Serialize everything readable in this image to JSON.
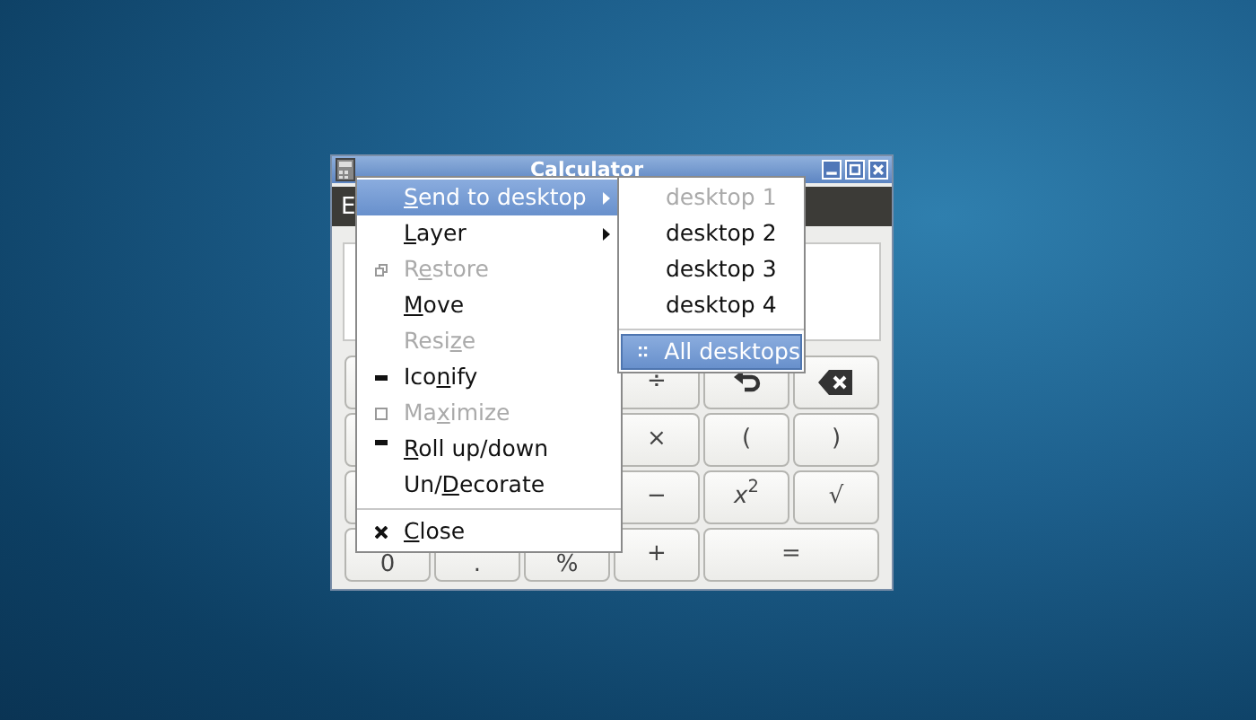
{
  "window": {
    "title": "Calculator",
    "menubar_text": "E"
  },
  "keypad": [
    [
      {
        "kind": "text",
        "label": "÷"
      },
      {
        "kind": "undo"
      },
      {
        "kind": "backspace"
      }
    ],
    [
      {
        "kind": "text",
        "label": "×"
      },
      {
        "kind": "text",
        "label": "("
      },
      {
        "kind": "text",
        "label": ")"
      }
    ],
    [
      {
        "kind": "text",
        "label": "−"
      },
      {
        "kind": "text",
        "label": "*x*$^{2}$"
      },
      {
        "kind": "text",
        "label": "√"
      }
    ],
    [
      {
        "kind": "low",
        "label": "0"
      },
      {
        "kind": "low",
        "label": "."
      },
      {
        "kind": "low",
        "label": "%"
      },
      {
        "kind": "text",
        "label": "+"
      },
      {
        "kind": "wide",
        "label": "="
      }
    ]
  ],
  "window_menu": [
    {
      "kind": "item",
      "key": "S",
      "after": "end to desktop",
      "submenu": true,
      "disabled": false,
      "selected": true
    },
    {
      "kind": "item",
      "key": "L",
      "after": "ayer",
      "submenu": true,
      "disabled": false,
      "selected": false
    },
    {
      "kind": "item",
      "before": "R",
      "key": "e",
      "after": "store",
      "submenu": false,
      "disabled": true,
      "selected": false
    },
    {
      "kind": "item",
      "key": "M",
      "after": "ove",
      "submenu": false,
      "disabled": false,
      "selected": false
    },
    {
      "kind": "item",
      "before": "Resi",
      "key": "z",
      "after": "e",
      "submenu": false,
      "disabled": true,
      "selected": false
    },
    {
      "kind": "item",
      "before": "Ico",
      "key": "n",
      "after": "ify",
      "submenu": false,
      "disabled": false,
      "selected": false
    },
    {
      "kind": "item",
      "before": "Ma",
      "key": "x",
      "after": "imize",
      "submenu": false,
      "disabled": true,
      "selected": false
    },
    {
      "kind": "item",
      "key": "R",
      "after": "oll up/down",
      "submenu": false,
      "disabled": false,
      "selected": false
    },
    {
      "kind": "item",
      "before": "Un/",
      "key": "D",
      "after": "ecorate",
      "submenu": false,
      "disabled": false,
      "selected": false
    },
    {
      "kind": "separator"
    },
    {
      "kind": "item",
      "key": "C",
      "after": "lose",
      "submenu": false,
      "disabled": false,
      "selected": false
    }
  ],
  "desktop_submenu": [
    {
      "kind": "item",
      "label": "desktop 1",
      "disabled": true,
      "selected": false
    },
    {
      "kind": "item",
      "label": "desktop 2",
      "disabled": false,
      "selected": false
    },
    {
      "kind": "item",
      "label": "desktop 3",
      "disabled": false,
      "selected": false
    },
    {
      "kind": "item",
      "label": "desktop 4",
      "disabled": false,
      "selected": false
    },
    {
      "kind": "separator"
    },
    {
      "kind": "all",
      "label": "All desktops",
      "disabled": false,
      "selected": true
    }
  ]
}
